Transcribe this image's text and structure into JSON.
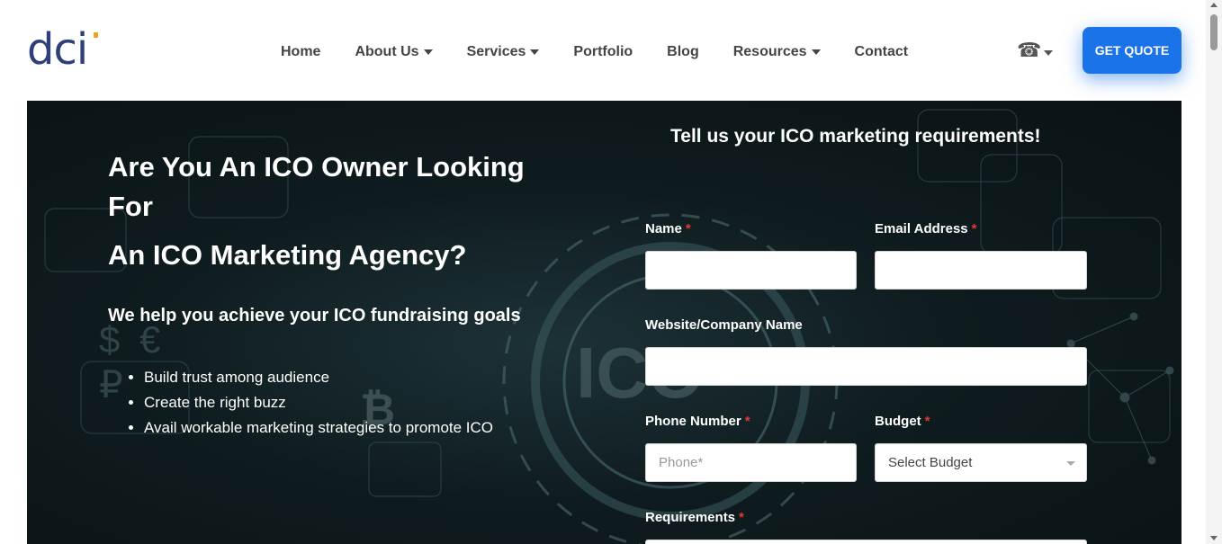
{
  "header": {
    "logo_text": "dci",
    "nav": [
      {
        "label": "Home",
        "has_dropdown": false
      },
      {
        "label": "About Us",
        "has_dropdown": true
      },
      {
        "label": "Services",
        "has_dropdown": true
      },
      {
        "label": "Portfolio",
        "has_dropdown": false
      },
      {
        "label": "Blog",
        "has_dropdown": false
      },
      {
        "label": "Resources",
        "has_dropdown": true
      },
      {
        "label": "Contact",
        "has_dropdown": false
      }
    ],
    "phone_icon": "phone-icon",
    "quote_button": "GET QUOTE"
  },
  "hero": {
    "title_line1": "Are You An ICO Owner Looking For",
    "title_line2": "An ICO Marketing Agency?",
    "subtitle": "We help you achieve your ICO fundraising goals",
    "bullets": [
      "Build trust among audience",
      "Create the right buzz",
      "Avail workable marketing strategies to promote ICO"
    ]
  },
  "form": {
    "title": "Tell us your ICO marketing requirements!",
    "name_label": "Name",
    "email_label": "Email Address",
    "website_label": "Website/Company Name",
    "phone_label": "Phone Number",
    "phone_placeholder": "Phone*",
    "budget_label": "Budget",
    "budget_value": "Select Budget",
    "requirements_label": "Requirements",
    "required_mark": "*"
  },
  "colors": {
    "accent": "#1a73e8",
    "required": "#e53935",
    "logo": "#2f3f77",
    "logo_dot": "#f2a21a",
    "hero_bg": "#0f1c1f"
  }
}
